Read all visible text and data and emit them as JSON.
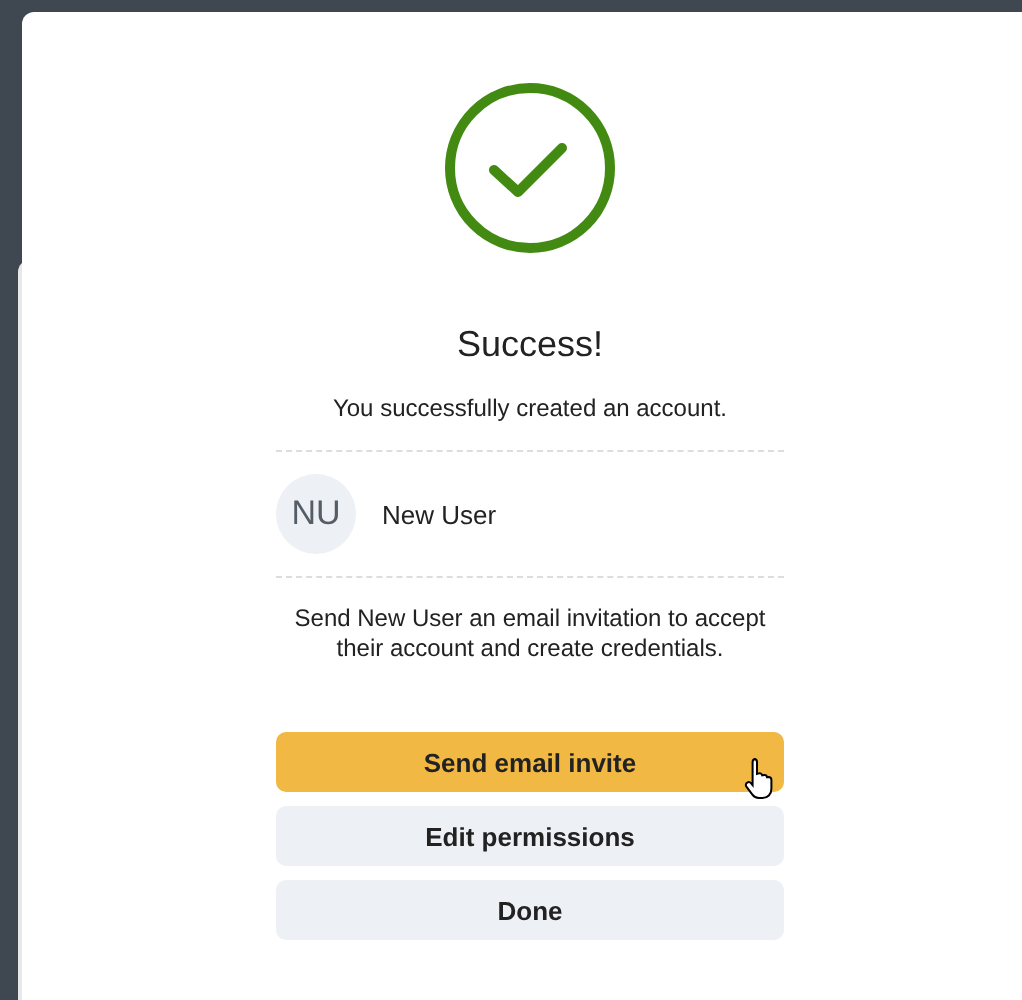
{
  "dialog": {
    "title": "Success!",
    "message": "You successfully created an account.",
    "user": {
      "initials": "NU",
      "name": "New User"
    },
    "note": "Send New User an email invitation to accept their account and create credentials.",
    "buttons": [
      {
        "label": "Send email invite",
        "kind": "primary"
      },
      {
        "label": "Edit permissions",
        "kind": "secondary"
      },
      {
        "label": "Done",
        "kind": "secondary"
      }
    ]
  }
}
